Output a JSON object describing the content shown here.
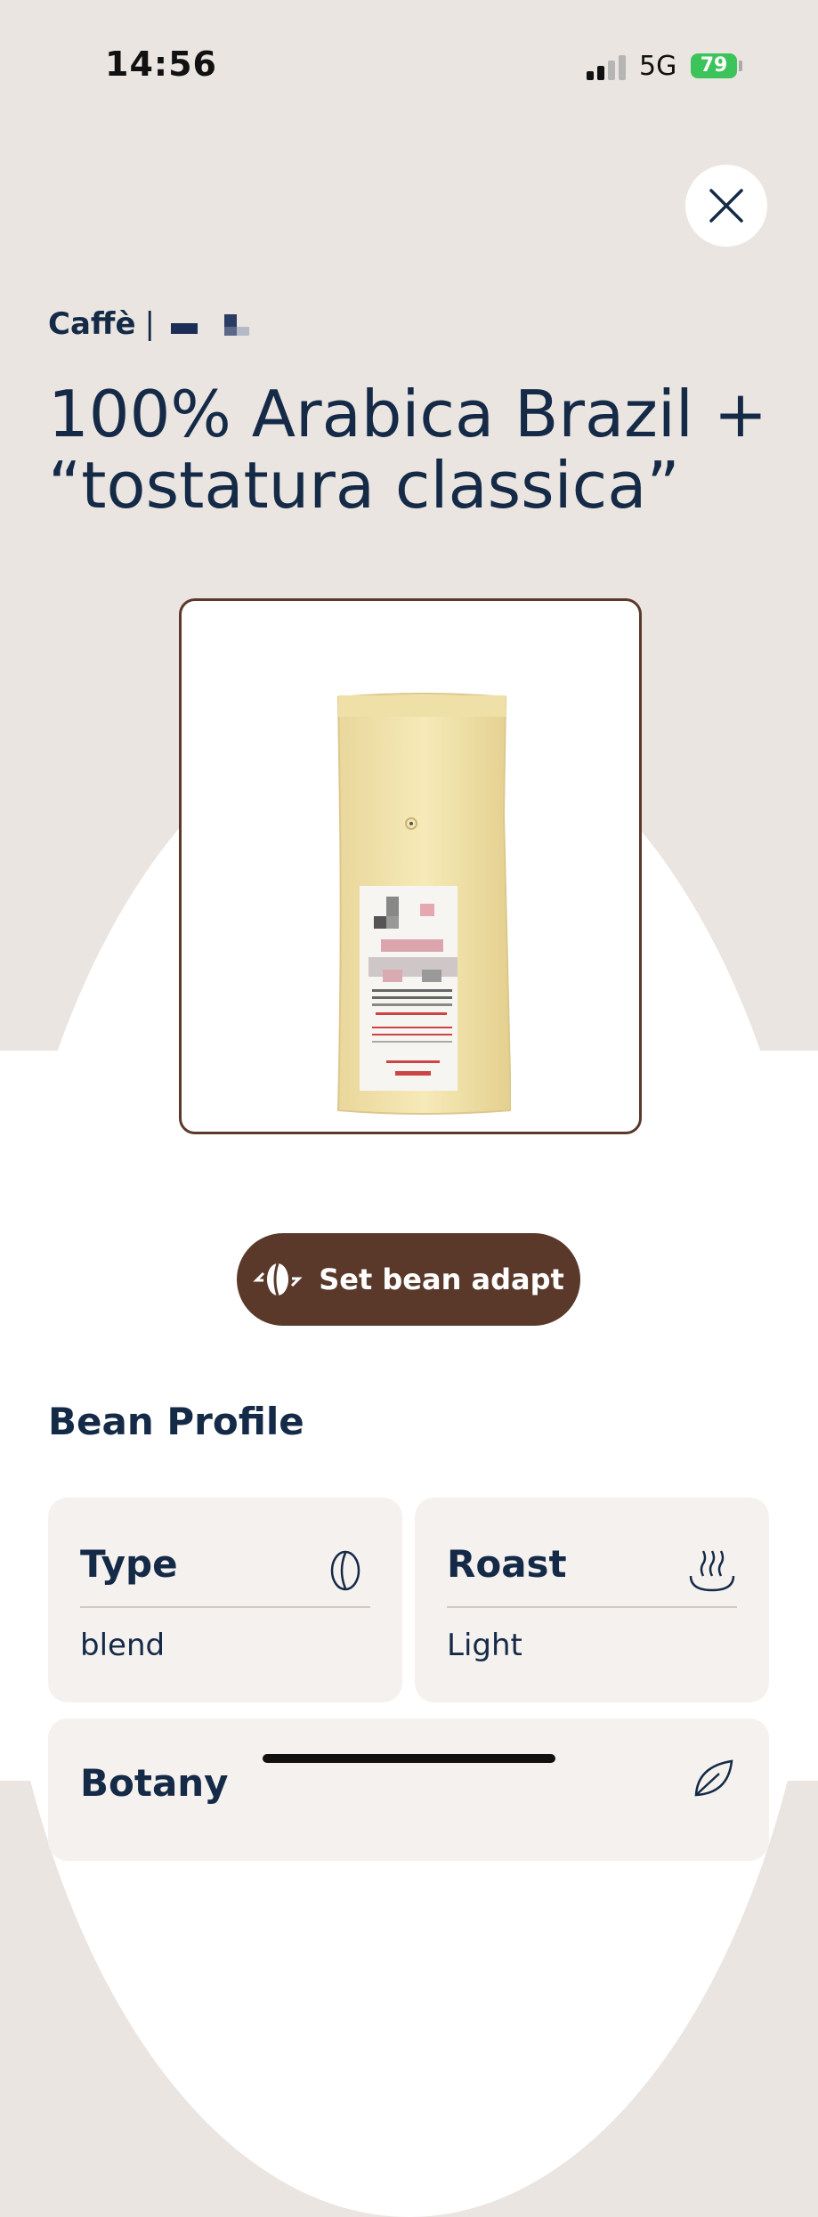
{
  "status_bar": {
    "time": "14:56",
    "network": "5G",
    "battery": "79"
  },
  "header": {
    "category": "Caffè",
    "separator": "|"
  },
  "product": {
    "title": "100% Arabica Brazil + “tostatura classica”"
  },
  "actions": {
    "set_bean_label": "Set bean adapt"
  },
  "bean_profile": {
    "title": "Bean Profile",
    "cards": [
      {
        "label": "Type",
        "value": "blend",
        "icon": "coffee-bean-icon"
      },
      {
        "label": "Roast",
        "value": "Light",
        "icon": "roast-heat-icon"
      },
      {
        "label": "Botany",
        "icon": "leaf-icon"
      }
    ]
  },
  "colors": {
    "background": "#ebe5e1",
    "accent": "#5a392b",
    "text": "#142a47",
    "card": "#f5f1ee"
  }
}
